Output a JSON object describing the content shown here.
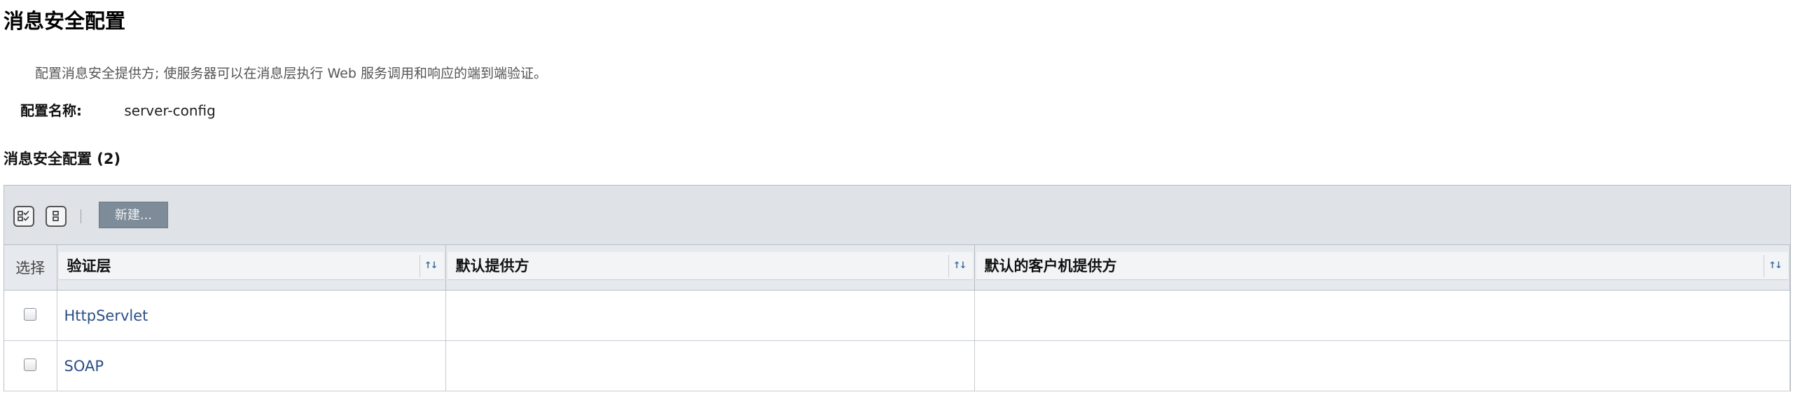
{
  "page": {
    "title": "消息安全配置",
    "description": "配置消息安全提供方; 使服务器可以在消息层执行 Web 服务调用和响应的端到端验证。",
    "config_label": "配置名称:",
    "config_value": "server-config"
  },
  "section": {
    "title": "消息安全配置 (2)"
  },
  "toolbar": {
    "select_all_icon": "select-all-icon",
    "deselect_all_icon": "deselect-all-icon",
    "new_label": "新建..."
  },
  "table": {
    "headers": {
      "select": "选择",
      "auth_layer": "验证层",
      "default_provider": "默认提供方",
      "default_client_provider": "默认的客户机提供方"
    },
    "rows": [
      {
        "auth_layer": "HttpServlet",
        "default_provider": "",
        "default_client_provider": ""
      },
      {
        "auth_layer": "SOAP",
        "default_provider": "",
        "default_client_provider": ""
      }
    ]
  },
  "colors": {
    "toolbar_bg": "#dfe3e8",
    "link": "#2b4f87",
    "new_button_bg": "#7e8b98"
  }
}
